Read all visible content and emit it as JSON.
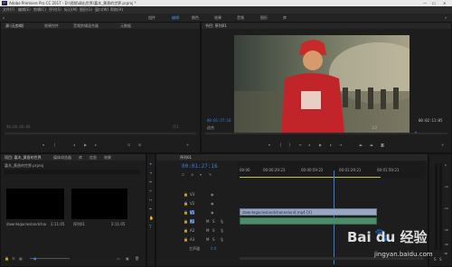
{
  "app": {
    "title": "Adobe Premiere Pro CC 2017 - D:\\视频\\调出世界\\嘉木_黄昏的世界.prproj *",
    "window_controls": {
      "minimize": "—",
      "maximize": "☐",
      "close": "✕"
    }
  },
  "menu": [
    "文件(F)",
    "编辑(E)",
    "剪辑(C)",
    "序列(S)",
    "标记(M)",
    "图形(G)",
    "窗口(W)",
    "帮助(H)"
  ],
  "workspaces": [
    "组件",
    "编辑",
    "颜色",
    "效果",
    "音频",
    "图形",
    "库"
  ],
  "highlight_color": "#e0302d",
  "source_panel": {
    "tabs": [
      "源:(无剪辑)",
      "效果控件",
      "音频剪辑混合器",
      "元数据"
    ],
    "timecode": "00;00;00;00",
    "page_label": "页1"
  },
  "program_panel": {
    "tab": "节目: 序列01",
    "timecode_start": "00:01:27:16",
    "fit": "适合",
    "ratio": "1/2",
    "timecode_end": "00:02:11:05"
  },
  "project_panel": {
    "tabs": [
      "项目: 嘉木_黄昏的世界",
      "媒体浏览器",
      "库",
      "信息",
      "效果"
    ],
    "path": "嘉木_黄昏的世界.prproj",
    "items": [
      {
        "name": "dawnlegacieslandchannelunit.mp4",
        "duration": "2:11:05"
      },
      {
        "name": "序列01",
        "duration": "2:11:05"
      }
    ]
  },
  "timeline": {
    "tab": "序列01",
    "timecode": "00:01:27:16",
    "ruler": [
      "00:00",
      "00:00:29:23",
      "00:00:59:22",
      "00:01:29:21",
      "00:01:59:21"
    ],
    "tracks": [
      "V3",
      "V2",
      "V1",
      "A1",
      "A2",
      "A3"
    ],
    "track_toggles": [
      "M",
      "S",
      "M",
      "S",
      "M",
      "S"
    ],
    "clip_video": "dawnlegacieslandchannelunit.mp4 [V]",
    "master_label": "主声道",
    "master_value": "0.0"
  },
  "meter_labels": [
    "0",
    "-12",
    "-24",
    "-36",
    "-48",
    "dB"
  ],
  "watermark": {
    "main": "Bai du 经验",
    "sub": "jingyan.baidu.com"
  }
}
